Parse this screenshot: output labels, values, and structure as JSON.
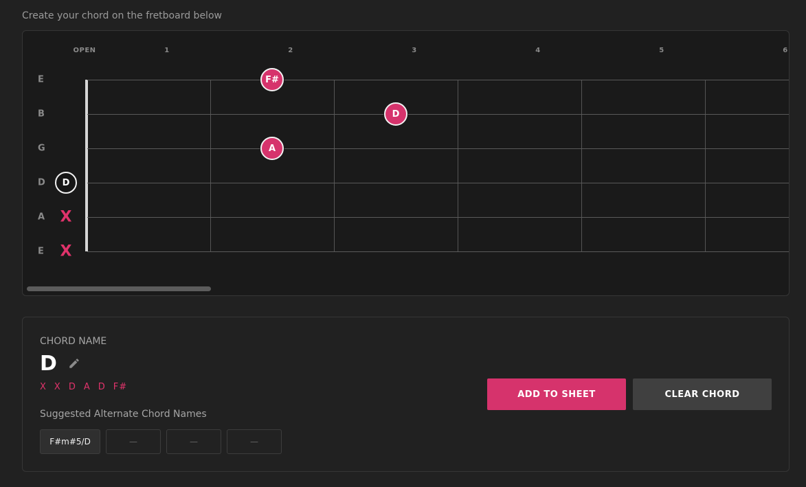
{
  "instruction": "Create your chord on the fretboard below",
  "fretboard": {
    "fret_labels": [
      "OPEN",
      "1",
      "2",
      "3",
      "4",
      "5",
      "6"
    ],
    "string_labels": [
      "E",
      "B",
      "G",
      "D",
      "A",
      "E"
    ],
    "notes": [
      {
        "string": 0,
        "fret": 2,
        "label": "F#",
        "kind": "fretted"
      },
      {
        "string": 1,
        "fret": 3,
        "label": "D",
        "kind": "fretted"
      },
      {
        "string": 2,
        "fret": 2,
        "label": "A",
        "kind": "fretted"
      },
      {
        "string": 3,
        "fret": 0,
        "label": "D",
        "kind": "open"
      },
      {
        "string": 4,
        "fret": -1,
        "label": "X",
        "kind": "muted"
      },
      {
        "string": 5,
        "fret": -1,
        "label": "X",
        "kind": "muted"
      }
    ]
  },
  "chord": {
    "name_label": "CHORD NAME",
    "name": "D",
    "notes": [
      "X",
      "X",
      "D",
      "A",
      "D",
      "F#"
    ],
    "alternates_label": "Suggested Alternate Chord Names",
    "alternates": [
      "F#m#5/D",
      "—",
      "—",
      "—"
    ]
  },
  "buttons": {
    "add": "ADD TO SHEET",
    "clear": "CLEAR CHORD"
  },
  "colors": {
    "accent": "#d6336c",
    "background": "#212121",
    "fretboard": "#1a1a1a"
  },
  "icons": {
    "edit": "pencil-icon"
  }
}
